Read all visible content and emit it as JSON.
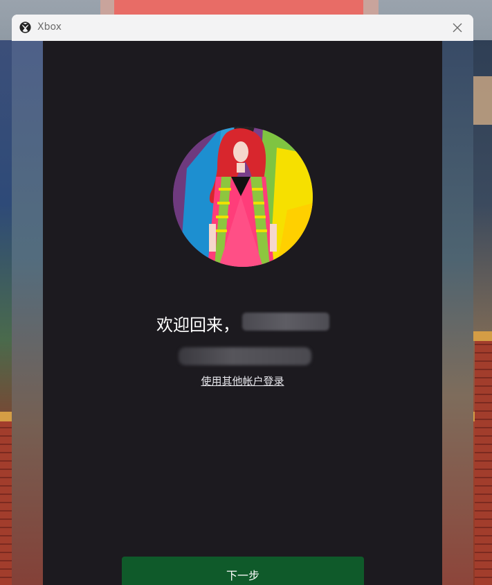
{
  "window": {
    "title": "Xbox",
    "close_icon": "close-icon",
    "app_icon": "xbox-logo-icon"
  },
  "signin": {
    "avatar_icon": "avatar-image",
    "welcome_text": "欢迎回来，",
    "switch_account_link": "使用其他帐户登录",
    "next_button_label": "下一步"
  },
  "colors": {
    "panel_bg": "#1c1a1f",
    "titlebar_bg": "#f3f3f4",
    "next_button_bg": "#0f5a2a"
  }
}
